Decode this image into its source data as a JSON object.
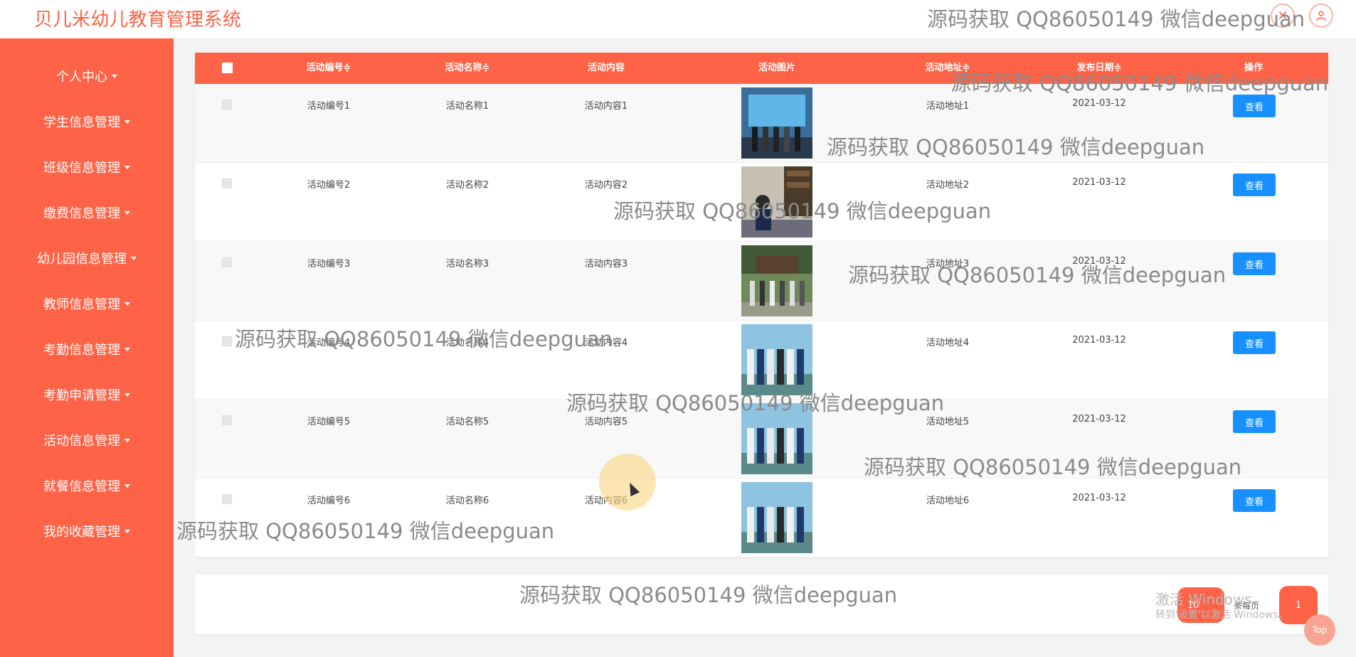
{
  "app": {
    "title": "贝儿米幼儿教育管理系统"
  },
  "header": {
    "close_icon": "close-icon",
    "user_icon": "user-icon"
  },
  "sidebar": {
    "items": [
      {
        "label": "个人中心"
      },
      {
        "label": "学生信息管理"
      },
      {
        "label": "班级信息管理"
      },
      {
        "label": "缴费信息管理"
      },
      {
        "label": "幼儿园信息管理"
      },
      {
        "label": "教师信息管理"
      },
      {
        "label": "考勤信息管理"
      },
      {
        "label": "考勤申请管理"
      },
      {
        "label": "活动信息管理"
      },
      {
        "label": "就餐信息管理"
      },
      {
        "label": "我的收藏管理"
      }
    ]
  },
  "table": {
    "columns": [
      "活动编号≑",
      "活动名称≑",
      "活动内容",
      "活动图片",
      "活动地址≑",
      "发布日期≑",
      "操作"
    ],
    "view_label": "查看",
    "rows": [
      {
        "code": "活动编号1",
        "name": "活动名称1",
        "content": "活动内容1",
        "address": "活动地址1",
        "date": "2021-03-12"
      },
      {
        "code": "活动编号2",
        "name": "活动名称2",
        "content": "活动内容2",
        "address": "活动地址2",
        "date": "2021-03-12"
      },
      {
        "code": "活动编号3",
        "name": "活动名称3",
        "content": "活动内容3",
        "address": "活动地址3",
        "date": "2021-03-12"
      },
      {
        "code": "活动编号4",
        "name": "活动名称4",
        "content": "活动内容4",
        "address": "活动地址4",
        "date": "2021-03-12"
      },
      {
        "code": "活动编号5",
        "name": "活动名称5",
        "content": "活动内容5",
        "address": "活动地址5",
        "date": "2021-03-12"
      },
      {
        "code": "活动编号6",
        "name": "活动名称6",
        "content": "活动内容6",
        "address": "活动地址6",
        "date": "2021-03-12"
      }
    ]
  },
  "pagination": {
    "page_size": "10",
    "page_size_label": "条每页",
    "current_page": "1",
    "top_label": "Top"
  },
  "system_overlay": {
    "activate_title": "激活 Windows",
    "activate_sub": "转到'设置'以激活 Windows。"
  },
  "watermark_text": "源码获取 QQ86050149 微信deepguan",
  "colors": {
    "accent": "#ff6347",
    "button": "#1890ff"
  }
}
